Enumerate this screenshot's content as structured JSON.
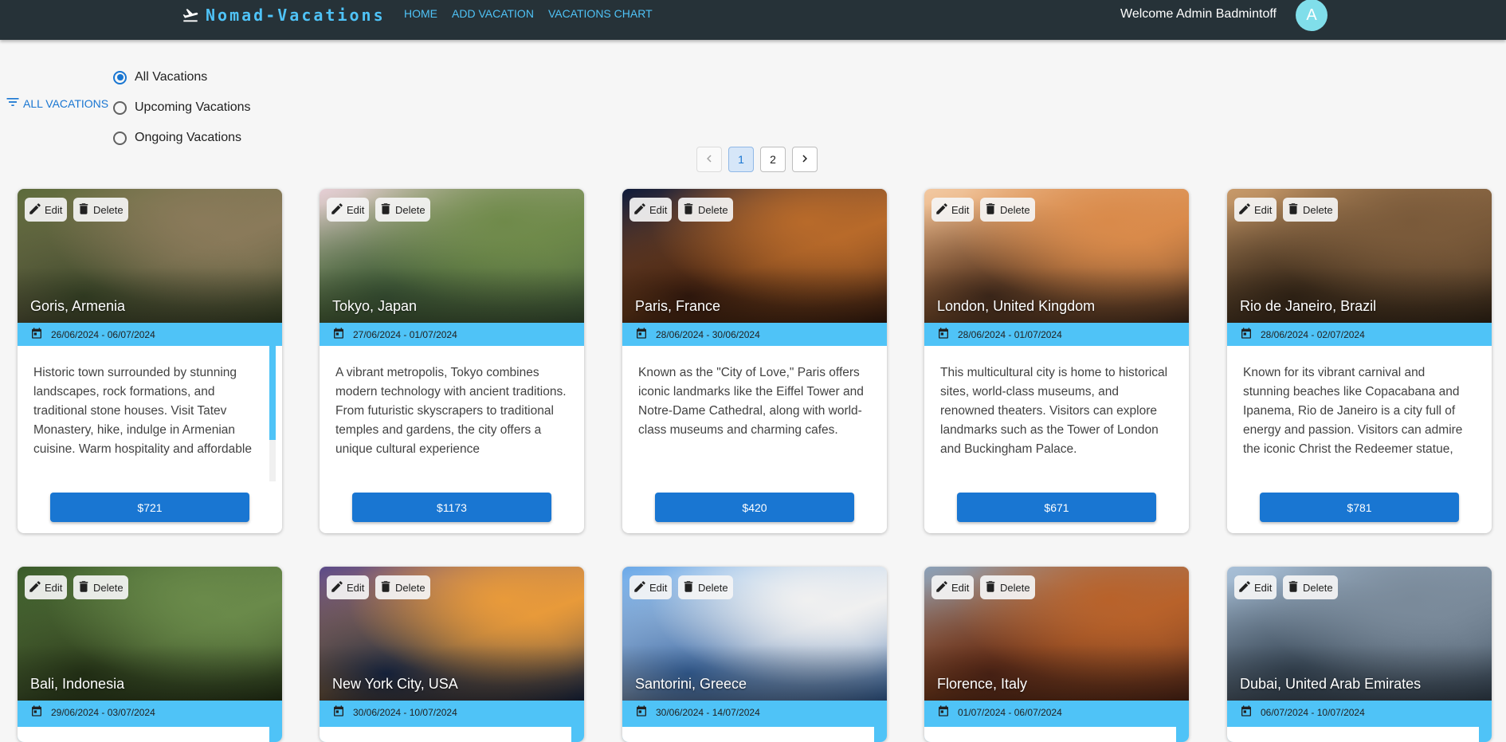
{
  "header": {
    "brand": "Nomad-Vacations",
    "nav": [
      "HOME",
      "ADD VACATION",
      "VACATIONS CHART"
    ],
    "welcome": "Welcome Admin Badmintoff",
    "avatar_letter": "A"
  },
  "filter": {
    "button_label": "ALL VACATIONS",
    "options": [
      {
        "label": "All Vacations",
        "checked": true
      },
      {
        "label": "Upcoming Vacations",
        "checked": false
      },
      {
        "label": "Ongoing Vacations",
        "checked": false
      }
    ]
  },
  "pagination": {
    "pages": [
      "1",
      "2"
    ],
    "current": "1"
  },
  "card_actions": {
    "edit": "Edit",
    "delete": "Delete"
  },
  "vacations": [
    {
      "title": "Goris, Armenia",
      "dates": "26/06/2024 - 06/07/2024",
      "description": "Historic town surrounded by stunning landscapes, rock formations, and traditional stone houses. Visit Tatev Monastery, hike, indulge in Armenian cuisine. Warm hospitality and affordable prices. Immerse in culture, beauty, and",
      "price": "$721",
      "has_scrollbar": true,
      "palette": [
        "#5b6a3a",
        "#8a7a5a",
        "#3d4a2a"
      ]
    },
    {
      "title": "Tokyo, Japan",
      "dates": "27/06/2024 - 01/07/2024",
      "description": "A vibrant metropolis, Tokyo combines modern technology with ancient traditions. From futuristic skyscrapers to traditional temples and gardens, the city offers a unique cultural experience",
      "price": "$1173",
      "has_scrollbar": false,
      "palette": [
        "#e6cfd6",
        "#6f8a4a",
        "#3f5a3a"
      ]
    },
    {
      "title": "Paris, France",
      "dates": "28/06/2024 - 30/06/2024",
      "description": "Known as the \"City of Love,\" Paris offers iconic landmarks like the Eiffel Tower and Notre-Dame Cathedral, along with world-class museums and charming cafes.",
      "price": "$420",
      "has_scrollbar": false,
      "palette": [
        "#0d1a3a",
        "#b86a2a",
        "#3a1d10"
      ]
    },
    {
      "title": "London, United Kingdom",
      "dates": "28/06/2024 - 01/07/2024",
      "description": "This multicultural city is home to historical sites, world-class museums, and renowned theaters. Visitors can explore landmarks such as the Tower of London and Buckingham Palace.",
      "price": "$671",
      "has_scrollbar": false,
      "palette": [
        "#f2c9a2",
        "#d98a4a",
        "#4a3020"
      ]
    },
    {
      "title": "Rio de Janeiro, Brazil",
      "dates": "28/06/2024 - 02/07/2024",
      "description": "Known for its vibrant carnival and stunning beaches like Copacabana and Ipanema, Rio de Janeiro is a city full of energy and passion. Visitors can admire the iconic Christ the Redeemer statue, enjoy samba music, and explore lush",
      "price": "$781",
      "has_scrollbar": false,
      "palette": [
        "#c89a6a",
        "#7a5a3a",
        "#3a2a1a"
      ]
    },
    {
      "title": "Bali, Indonesia",
      "dates": "29/06/2024 - 03/07/2024",
      "palette": [
        "#3a5a2a",
        "#6a8a4a",
        "#2a3a1a"
      ]
    },
    {
      "title": "New York City, USA",
      "dates": "30/06/2024 - 10/07/2024",
      "palette": [
        "#5a4a8a",
        "#e89a3a",
        "#1a2a4a"
      ]
    },
    {
      "title": "Santorini, Greece",
      "dates": "30/06/2024 - 14/07/2024",
      "palette": [
        "#6aa8e8",
        "#f0f0f0",
        "#3a6aa8"
      ]
    },
    {
      "title": "Florence, Italy",
      "dates": "01/07/2024 - 06/07/2024",
      "palette": [
        "#8aa0b8",
        "#b8622a",
        "#5a2a1a"
      ]
    },
    {
      "title": "Dubai, United Arab Emirates",
      "dates": "06/07/2024 - 10/07/2024",
      "palette": [
        "#a8c0d8",
        "#7a8a9a",
        "#3a4a5a"
      ]
    }
  ]
}
